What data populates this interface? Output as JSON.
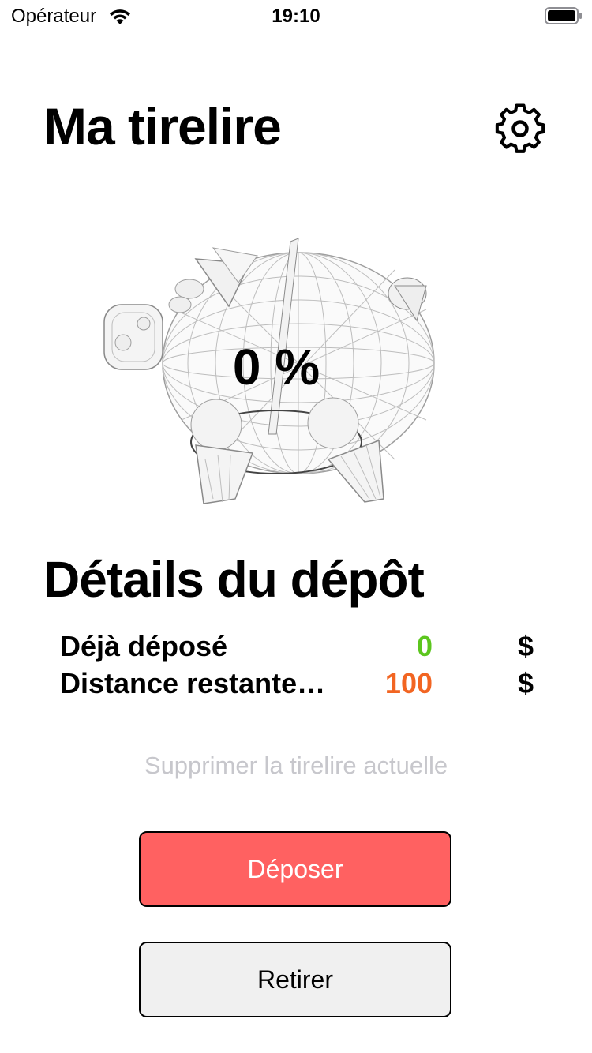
{
  "status_bar": {
    "carrier": "Opérateur",
    "time": "19:10"
  },
  "header": {
    "title": "Ma tirelire",
    "settings_icon": "gear-icon"
  },
  "piggy": {
    "icon": "piggy-bank-wireframe",
    "percent_label": "0 %"
  },
  "details": {
    "title": "Détails du dépôt",
    "rows": [
      {
        "label": "Déjà déposé",
        "value": "0",
        "currency": "$",
        "color": "#5cc61e"
      },
      {
        "label": "Distance restante…",
        "value": "100",
        "currency": "$",
        "color": "#f26522"
      }
    ]
  },
  "actions": {
    "delete_label": "Supprimer la tirelire actuelle",
    "deposit_label": "Déposer",
    "withdraw_label": "Retirer",
    "deposit_color": "#ff6161",
    "withdraw_color": "#f0f0f0"
  }
}
